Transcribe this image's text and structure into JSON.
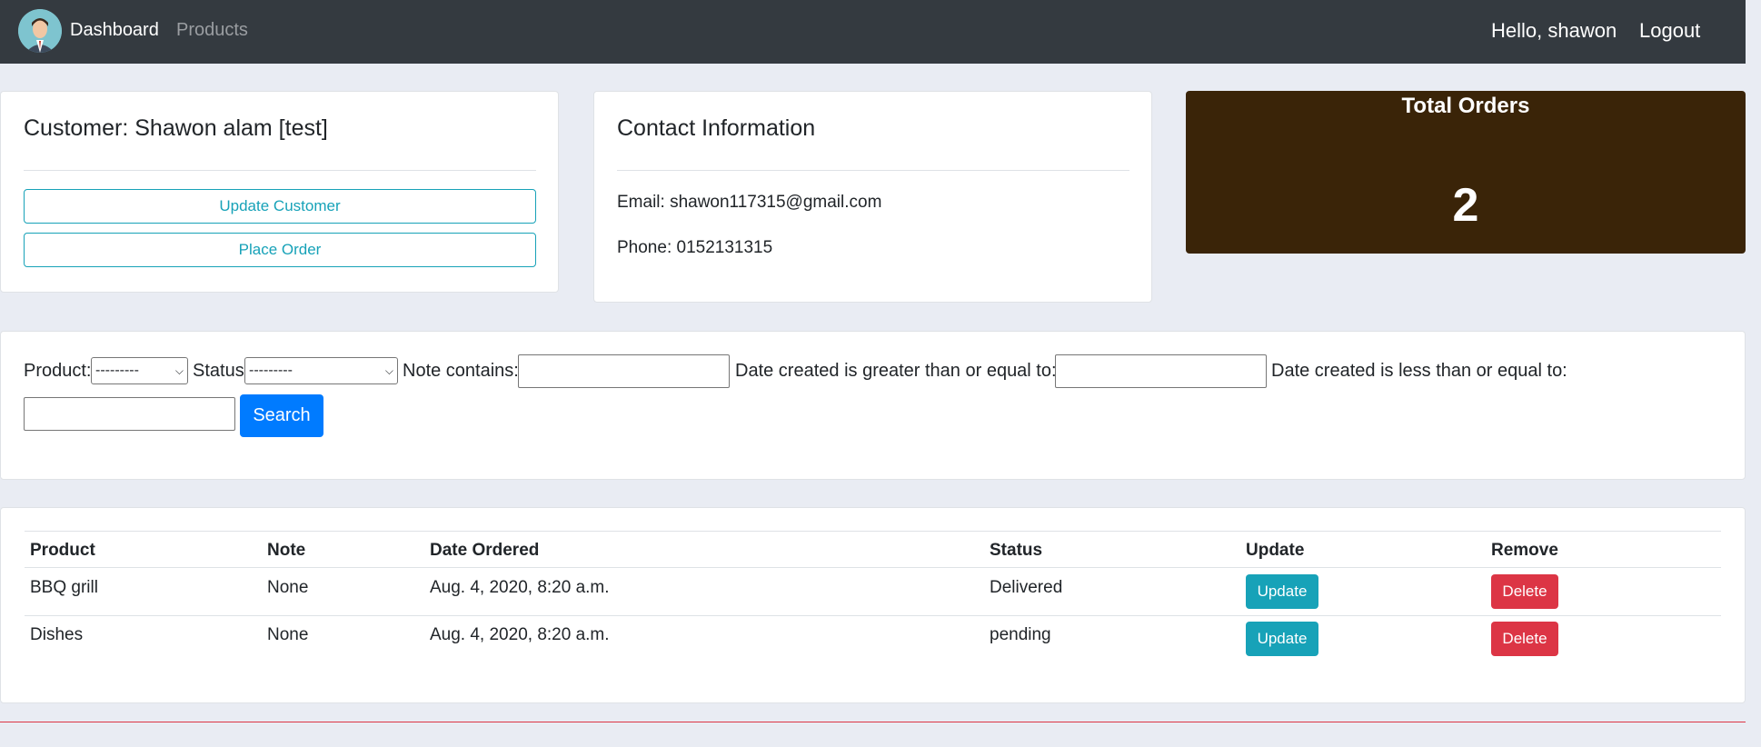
{
  "navbar": {
    "dashboard": "Dashboard",
    "products": "Products",
    "greeting": "Hello, shawon",
    "logout": "Logout"
  },
  "customer": {
    "title": "Customer: Shawon alam [test]",
    "update_button": "Update Customer",
    "place_order_button": "Place Order"
  },
  "contact": {
    "title": "Contact Information",
    "email": "Email: shawon117315@gmail.com",
    "phone": "Phone: 0152131315"
  },
  "total_orders": {
    "title": "Total Orders",
    "value": "2"
  },
  "filter": {
    "product_label": "Product:",
    "product_selected": "---------",
    "status_label": "Status:",
    "status_selected": "---------",
    "note_label": "Note contains:",
    "date_gte_label": "Date created is greater than or equal to:",
    "date_lte_label": "Date created is less than or equal to:",
    "search_button": "Search"
  },
  "orders": {
    "headers": [
      "Product",
      "Note",
      "Date Ordered",
      "Status",
      "Update",
      "Remove"
    ],
    "rows": [
      {
        "product": "BBQ grill",
        "note": "None",
        "date": "Aug. 4, 2020, 8:20 a.m.",
        "status": "Delivered",
        "update": "Update",
        "remove": "Delete"
      },
      {
        "product": "Dishes",
        "note": "None",
        "date": "Aug. 4, 2020, 8:20 a.m.",
        "status": "pending",
        "update": "Update",
        "remove": "Delete"
      }
    ]
  },
  "colors": {
    "navbar": "#343a40",
    "total_card": "#3a2408",
    "info": "#17a2b8",
    "primary": "#007bff",
    "danger": "#dc3545"
  }
}
